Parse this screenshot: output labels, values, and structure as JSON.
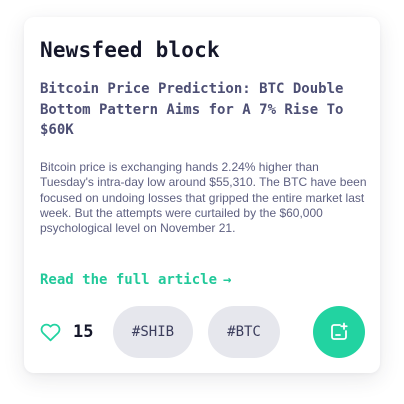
{
  "card": {
    "title": "Newsfeed block",
    "headline": "Bitcoin Price Prediction: BTC Double Bottom Pattern Aims for A 7% Rise To $60K",
    "body": "Bitcoin price is exchanging hands 2.24% higher than Tuesday's intra-day low around $55,310. The BTC have been focused on undoing losses that gripped the entire market last week. But the attempts were curtailed by the $60,000 psychological level on November 21.",
    "read_more_label": "Read the full article",
    "read_more_arrow": "→",
    "likes": {
      "count": "15",
      "icon": "heart-icon"
    },
    "tags": [
      "#SHIB",
      "#BTC"
    ],
    "share": {
      "icon": "add-to-collection-icon"
    }
  },
  "colors": {
    "accent": "#22d3a1",
    "link": "#22c99a",
    "title": "#15172a",
    "headline": "#4d4f74",
    "body": "#5e6081",
    "tag_background": "#e6e7ed"
  }
}
